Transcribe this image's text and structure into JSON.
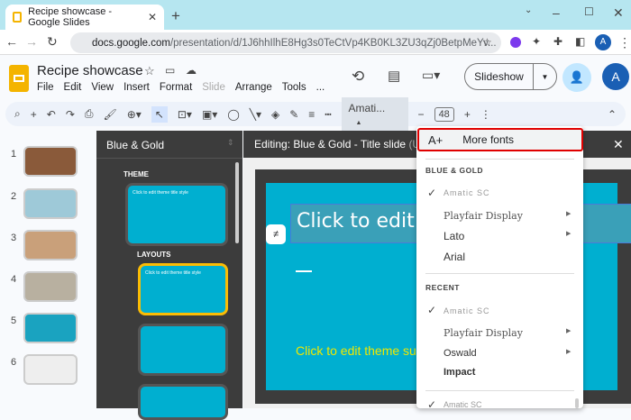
{
  "browser": {
    "tab_title": "Recipe showcase - Google Slides",
    "url_host": "docs.google.com",
    "url_path": "/presentation/d/1J6hhIlhE8Hg3s0TeCtVp4KB0KL3ZU3qZj0BetpMeYv...",
    "avatar": "A"
  },
  "doc": {
    "title": "Recipe showcase",
    "menu": [
      "File",
      "Edit",
      "View",
      "Insert",
      "Format",
      "Slide",
      "Arrange",
      "Tools",
      "..."
    ],
    "slideshow": "Slideshow",
    "avatar": "A"
  },
  "toolbar": {
    "font": "Amati...",
    "font_size": "48"
  },
  "filmstrip": [
    "1",
    "2",
    "3",
    "4",
    "5",
    "6"
  ],
  "theme_panel": {
    "title": "Blue & Gold",
    "theme_label": "THEME",
    "layouts_label": "LAYOUTS",
    "thumb_title": "Click to edit theme title style"
  },
  "editor": {
    "heading": "Editing: Blue & Gold - Title slide",
    "used_by": "(Used b",
    "title_placeholder": "Click to edit theme",
    "subtitle_placeholder": "Click to edit theme subt"
  },
  "font_menu": {
    "more_fonts": "More fonts",
    "section1": "BLUE & GOLD",
    "theme_fonts": [
      "Amatic SC",
      "Playfair Display",
      "Lato",
      "Arial"
    ],
    "section2": "RECENT",
    "recent_fonts": [
      "Amatic SC",
      "Playfair Display",
      "Oswald",
      "Impact"
    ],
    "bottom_font": "Amatic SC"
  },
  "colors": {
    "slide": "#00afd0",
    "highlight": "#e00000",
    "accent": "#fbbc04"
  }
}
